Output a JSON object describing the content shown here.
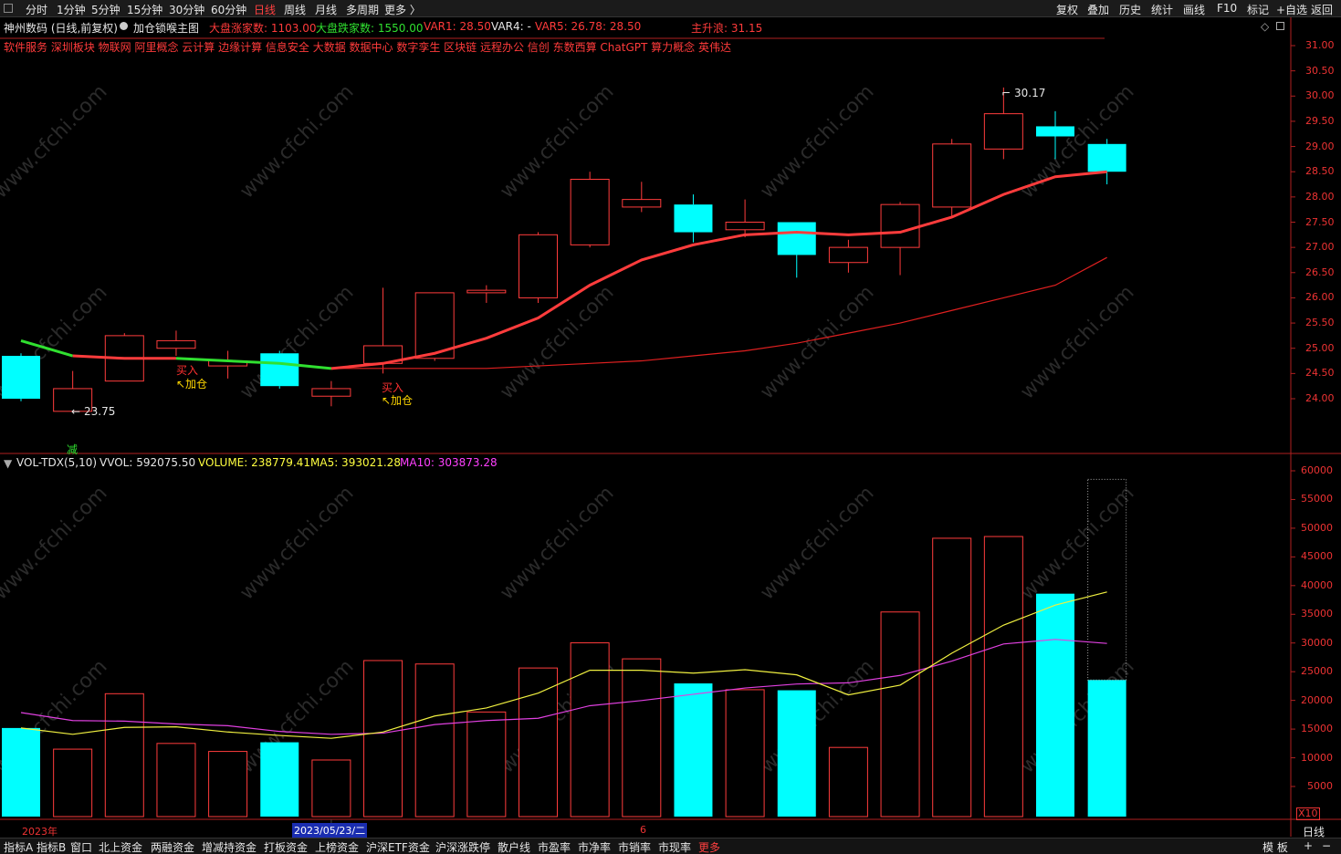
{
  "toolbar": {
    "periods": [
      "分时",
      "1分钟",
      "5分钟",
      "15分钟",
      "30分钟",
      "60分钟",
      "日线",
      "周线",
      "月线",
      "多周期",
      "更多 〉"
    ],
    "active_period": "日线",
    "right_tools": [
      "复权",
      "叠加",
      "历史",
      "统计",
      "画线",
      "F10",
      "标记",
      "+自选",
      "返回"
    ]
  },
  "header": {
    "stock": "神州数码 (日线,前复权)",
    "indicator": "加仓锁喉主图",
    "up_count": "大盘涨家数: 1103.00",
    "down_count": "大盘跌家数: 1550.00",
    "var1": "VAR1: 28.50",
    "var4": "VAR4: -",
    "var5": "VAR5: 26.78",
    "var5b": ": 28.50",
    "main": "主升浪: 31.15"
  },
  "concepts": "软件服务 深圳板块 物联网 阿里概念 云计算 边缘计算 信息安全 大数据 数据中心 数字孪生 区块链 远程办公 信创 东数西算 ChatGPT 算力概念 英伟达",
  "price_axis": [
    "31.00",
    "30.50",
    "30.00",
    "29.50",
    "29.00",
    "28.50",
    "28.00",
    "27.50",
    "27.00",
    "26.50",
    "26.00",
    "25.50",
    "25.00",
    "24.50",
    "24.00"
  ],
  "vol_header": {
    "name": "VOL-TDX(5,10)",
    "vvol": "VVOL: 592075.50",
    "volume": "VOLUME: 238779.41",
    "ma5": "MA5: 393021.28",
    "ma10": "MA10: 303873.28"
  },
  "vol_axis": [
    "60000",
    "55000",
    "50000",
    "45000",
    "40000",
    "35000",
    "30000",
    "25000",
    "20000",
    "15000",
    "10000",
    "5000"
  ],
  "vol_unit": "X10",
  "annotations": {
    "high": "30.17",
    "low": "23.75",
    "buy1": "买入",
    "add1": "↖加仓",
    "buy2": "买入",
    "add2": "↖加仓",
    "reduce": "减"
  },
  "date_axis": {
    "year": "2023年",
    "cursor_date": "2023/05/23/二",
    "month": "6"
  },
  "chart_data": {
    "type": "candlestick",
    "candles": [
      {
        "o": 24.85,
        "h": 24.9,
        "l": 23.95,
        "c": 24.0,
        "up": false
      },
      {
        "o": 23.75,
        "h": 24.55,
        "l": 23.75,
        "c": 24.2,
        "up": true
      },
      {
        "o": 24.35,
        "h": 25.3,
        "l": 24.35,
        "c": 25.25,
        "up": true
      },
      {
        "o": 25.0,
        "h": 25.35,
        "l": 24.85,
        "c": 25.15,
        "up": true
      },
      {
        "o": 24.65,
        "h": 24.95,
        "l": 24.4,
        "c": 24.75,
        "up": true
      },
      {
        "o": 24.9,
        "h": 24.95,
        "l": 24.2,
        "c": 24.25,
        "up": false
      },
      {
        "o": 24.05,
        "h": 24.35,
        "l": 23.85,
        "c": 24.2,
        "up": true
      },
      {
        "o": 24.7,
        "h": 26.2,
        "l": 24.5,
        "c": 25.05,
        "up": true
      },
      {
        "o": 24.8,
        "h": 26.1,
        "l": 24.75,
        "c": 26.1,
        "up": true
      },
      {
        "o": 26.1,
        "h": 26.25,
        "l": 25.9,
        "c": 26.15,
        "up": true
      },
      {
        "o": 26.0,
        "h": 27.3,
        "l": 25.9,
        "c": 27.25,
        "up": true
      },
      {
        "o": 27.05,
        "h": 28.5,
        "l": 27.0,
        "c": 28.35,
        "up": true
      },
      {
        "o": 27.8,
        "h": 28.3,
        "l": 27.7,
        "c": 27.95,
        "up": true
      },
      {
        "o": 27.85,
        "h": 28.05,
        "l": 27.1,
        "c": 27.3,
        "up": false
      },
      {
        "o": 27.35,
        "h": 27.95,
        "l": 27.2,
        "c": 27.5,
        "up": true
      },
      {
        "o": 27.5,
        "h": 27.5,
        "l": 26.4,
        "c": 26.85,
        "up": false
      },
      {
        "o": 26.7,
        "h": 27.15,
        "l": 26.5,
        "c": 27.0,
        "up": true
      },
      {
        "o": 27.0,
        "h": 27.9,
        "l": 26.45,
        "c": 27.85,
        "up": true
      },
      {
        "o": 27.8,
        "h": 29.15,
        "l": 27.6,
        "c": 29.05,
        "up": true
      },
      {
        "o": 28.95,
        "h": 30.17,
        "l": 28.75,
        "c": 29.65,
        "up": true
      },
      {
        "o": 29.4,
        "h": 29.7,
        "l": 28.75,
        "c": 29.2,
        "up": false
      },
      {
        "o": 29.05,
        "h": 29.15,
        "l": 28.25,
        "c": 28.5,
        "up": false
      }
    ],
    "ma_short": [
      25.15,
      24.85,
      24.8,
      24.8,
      24.75,
      24.7,
      24.6,
      24.7,
      24.9,
      25.2,
      25.6,
      26.25,
      26.75,
      27.05,
      27.25,
      27.3,
      27.25,
      27.3,
      27.6,
      28.05,
      28.4,
      28.5
    ],
    "ma_long": [
      null,
      null,
      null,
      null,
      null,
      null,
      24.6,
      24.6,
      24.6,
      24.6,
      24.65,
      24.7,
      24.75,
      24.85,
      24.95,
      25.1,
      25.3,
      25.5,
      25.75,
      26.0,
      26.25,
      26.8
    ],
    "ma_short_down_until": 6,
    "volume": [
      15500,
      11800,
      21500,
      12800,
      11400,
      13000,
      9900,
      27300,
      26700,
      18300,
      26000,
      30400,
      27600,
      23300,
      22200,
      22100,
      12100,
      35800,
      48700,
      49000,
      39000,
      23900
    ],
    "volume_projected": 59000,
    "vol_ma5": [
      15500,
      14400,
      15600,
      15700,
      14800,
      14200,
      13700,
      14800,
      17600,
      19000,
      21600,
      25600,
      25600,
      25100,
      25700,
      24800,
      21300,
      23000,
      28600,
      33500,
      37000,
      39300
    ],
    "vol_ma10": [
      18200,
      16800,
      16700,
      16200,
      15900,
      14900,
      14400,
      14600,
      16100,
      16800,
      17200,
      19400,
      20300,
      21400,
      22500,
      23200,
      23400,
      24700,
      27200,
      30200,
      31000,
      30300
    ],
    "price_range": [
      23.4,
      31.45
    ],
    "volume_range": [
      0,
      62000
    ]
  }
}
